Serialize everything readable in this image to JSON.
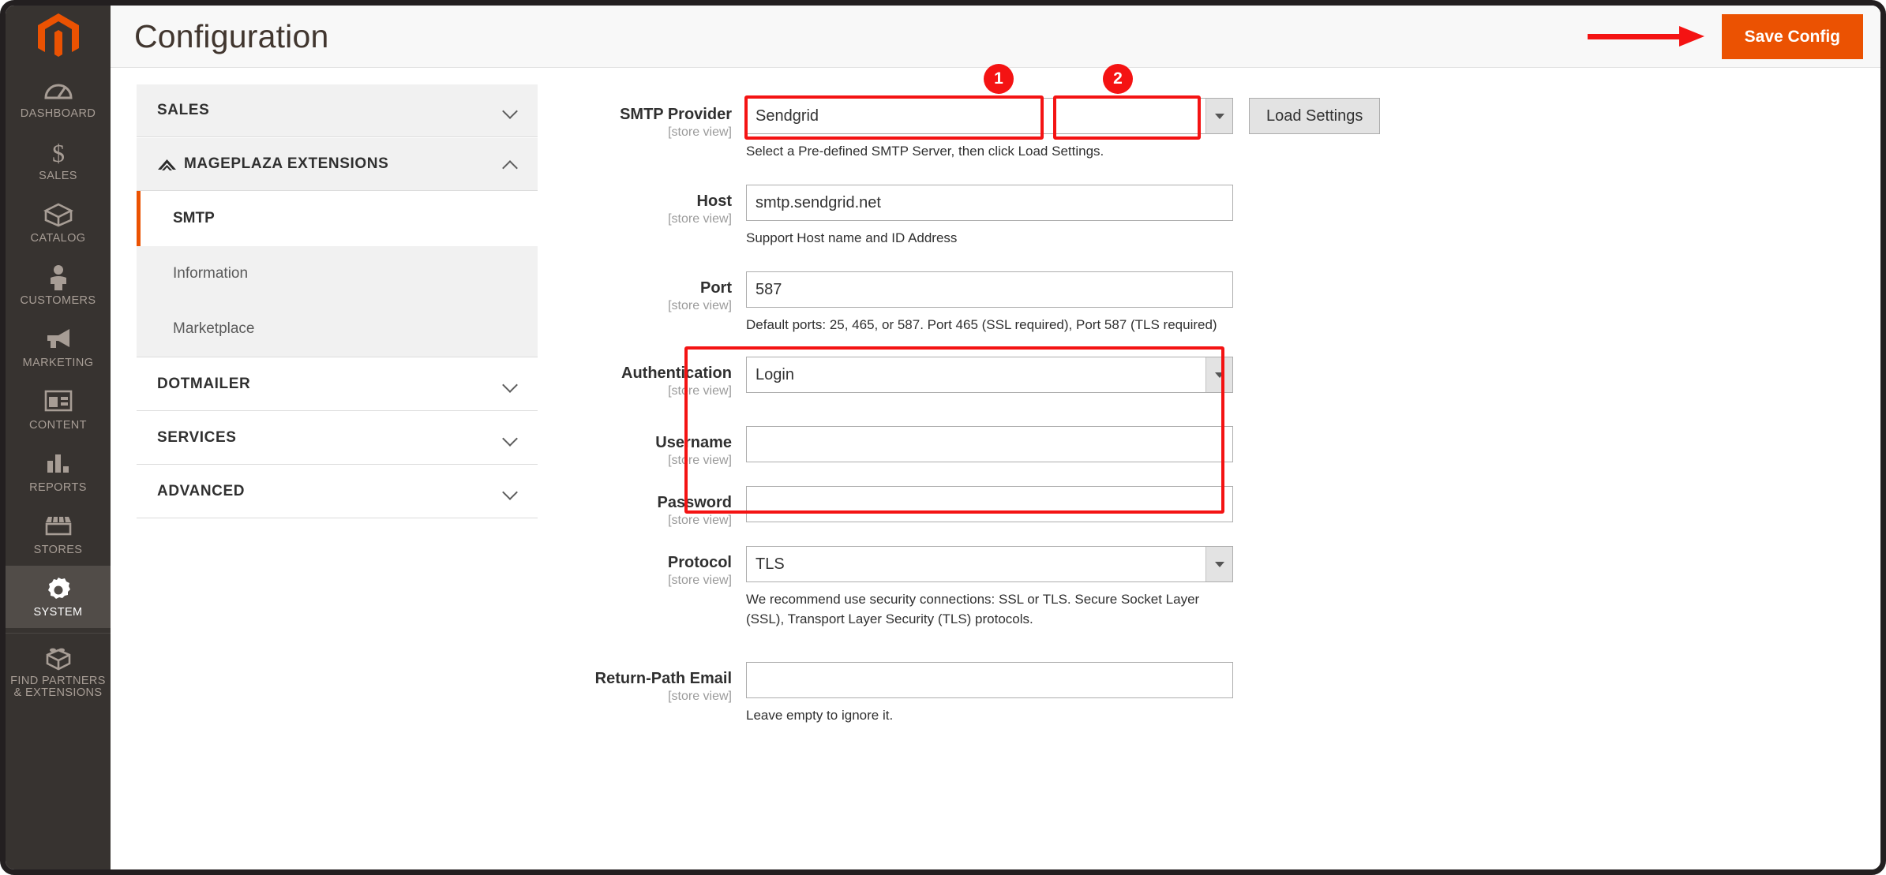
{
  "brand": {
    "logo_name": "magento-logo",
    "accent": "#eb5202",
    "annotation_color": "#f41313"
  },
  "sidebar": {
    "items": [
      {
        "label": "DASHBOARD",
        "icon": "dashboard-gauge-icon",
        "active": false
      },
      {
        "label": "SALES",
        "icon": "dollar-sign-icon",
        "active": false
      },
      {
        "label": "CATALOG",
        "icon": "box-icon",
        "active": false
      },
      {
        "label": "CUSTOMERS",
        "icon": "person-icon",
        "active": false
      },
      {
        "label": "MARKETING",
        "icon": "megaphone-icon",
        "active": false
      },
      {
        "label": "CONTENT",
        "icon": "layout-window-icon",
        "active": false
      },
      {
        "label": "REPORTS",
        "icon": "bar-chart-icon",
        "active": false
      },
      {
        "label": "STORES",
        "icon": "storefront-icon",
        "active": false
      },
      {
        "label": "SYSTEM",
        "icon": "gear-icon",
        "active": true
      },
      {
        "label": "FIND PARTNERS & EXTENSIONS",
        "icon": "lego-brick-icon",
        "active": false
      }
    ]
  },
  "header": {
    "title": "Configuration",
    "save_label": "Save Config"
  },
  "config_menu": {
    "sections": [
      {
        "label": "SALES",
        "expanded": false,
        "has_icon": false
      },
      {
        "label": "MAGEPLAZA EXTENSIONS",
        "expanded": true,
        "has_icon": true,
        "items": [
          {
            "label": "SMTP",
            "active": true
          },
          {
            "label": "Information",
            "active": false
          },
          {
            "label": "Marketplace",
            "active": false
          }
        ]
      },
      {
        "label": "DOTMAILER",
        "expanded": false,
        "has_icon": false
      },
      {
        "label": "SERVICES",
        "expanded": false,
        "has_icon": false
      },
      {
        "label": "ADVANCED",
        "expanded": false,
        "has_icon": false
      }
    ]
  },
  "form": {
    "scope_label": "[store view]",
    "smtp_provider": {
      "label": "SMTP Provider",
      "value": "Sendgrid",
      "hint": "Select a Pre-defined SMTP Server, then click Load Settings.",
      "load_settings_label": "Load Settings"
    },
    "host": {
      "label": "Host",
      "value": "smtp.sendgrid.net",
      "hint": "Support Host name and ID Address"
    },
    "port": {
      "label": "Port",
      "value": "587",
      "hint": "Default ports: 25, 465, or 587. Port 465 (SSL required), Port 587 (TLS required)"
    },
    "authentication": {
      "label": "Authentication",
      "value": "Login",
      "hint": ""
    },
    "username": {
      "label": "Username",
      "value": "",
      "hint": ""
    },
    "password": {
      "label": "Password",
      "value": "",
      "hint": ""
    },
    "protocol": {
      "label": "Protocol",
      "value": "TLS",
      "hint": "We recommend use security connections: SSL or TLS. Secure Socket Layer (SSL), Transport Layer Security (TLS) protocols."
    },
    "return_path_email": {
      "label": "Return-Path Email",
      "value": "",
      "hint": "Leave empty to ignore it."
    }
  },
  "annotations": {
    "badge_1": "1",
    "badge_2": "2"
  }
}
